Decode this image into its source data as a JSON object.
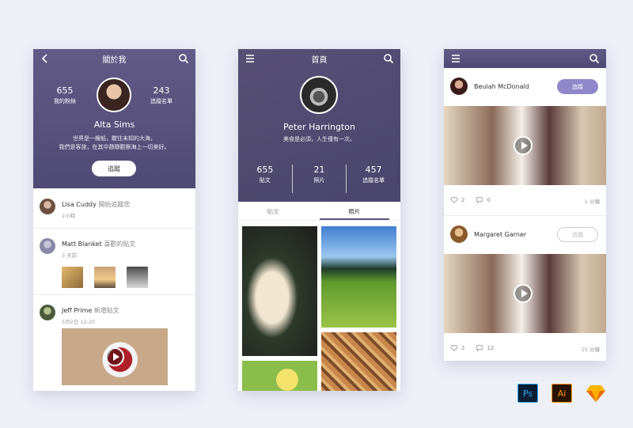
{
  "screen1": {
    "title": "關於我",
    "followers": {
      "count": "655",
      "label": "我的粉絲"
    },
    "following": {
      "count": "243",
      "label": "追蹤名單"
    },
    "name": "Alta Sims",
    "bio_line1": "世界是一艘船，駛往未知的大海，",
    "bio_line2": "我們是客旅，在其中靜靜觀察海上一切美好。",
    "follow_label": "追蹤",
    "feed": [
      {
        "name": "Lisa Cuddy",
        "action": "開始追蹤您",
        "time": "2小時"
      },
      {
        "name": "Matt Blanket",
        "action": "喜歡的貼文",
        "time": "3 天前"
      },
      {
        "name": "Jeff Prime",
        "action": "新增貼文",
        "time": "5月2日 12:20"
      }
    ]
  },
  "screen2": {
    "title": "首頁",
    "name": "Peter Harrington",
    "tagline": "美食是必須，人生僅有一次。",
    "stats": [
      {
        "count": "655",
        "label": "貼文"
      },
      {
        "count": "21",
        "label": "照片"
      },
      {
        "count": "457",
        "label": "追蹤名單"
      }
    ],
    "tabs": [
      "貼文",
      "照片"
    ]
  },
  "screen3": {
    "posts": [
      {
        "name": "Beulah McDonald",
        "button": "追蹤",
        "likes": "2",
        "comments": "0",
        "time": "1 分鐘"
      },
      {
        "name": "Margaret Garner",
        "button": "追蹤",
        "likes": "2",
        "comments": "12",
        "time": "15 分鐘"
      }
    ]
  },
  "apps": {
    "ps": "Ps",
    "ai": "Ai"
  },
  "colors": {
    "primary": "#5b547f",
    "button": "#8f88c9"
  }
}
